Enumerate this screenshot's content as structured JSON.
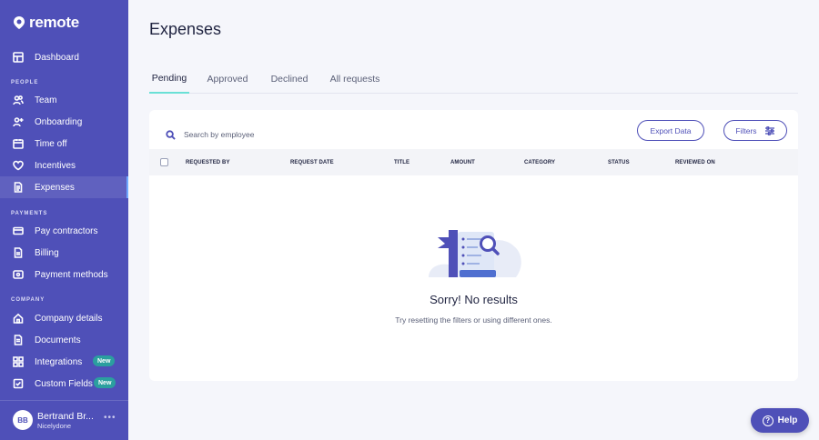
{
  "app": {
    "logo_text": "remote"
  },
  "sidebar": {
    "dashboard": "Dashboard",
    "section_people": "PEOPLE",
    "section_payments": "PAYMENTS",
    "section_company": "COMPANY",
    "items": [
      {
        "label": "Team",
        "icon": "users-icon"
      },
      {
        "label": "Onboarding",
        "icon": "user-plus-icon"
      },
      {
        "label": "Time off",
        "icon": "calendar-icon"
      },
      {
        "label": "Incentives",
        "icon": "heart-icon"
      },
      {
        "label": "Expenses",
        "icon": "receipt-icon"
      },
      {
        "label": "Pay contractors",
        "icon": "card-icon"
      },
      {
        "label": "Billing",
        "icon": "document-icon"
      },
      {
        "label": "Payment methods",
        "icon": "wallet-icon"
      },
      {
        "label": "Company details",
        "icon": "home-icon"
      },
      {
        "label": "Documents",
        "icon": "file-icon"
      },
      {
        "label": "Integrations",
        "icon": "grid-icon",
        "badge": "New"
      },
      {
        "label": "Custom Fields",
        "icon": "checkbox-icon",
        "badge": "New"
      }
    ],
    "user": {
      "initials": "BB",
      "name": "Bertrand Br...",
      "company": "Nicelydone"
    }
  },
  "page": {
    "title": "Expenses",
    "tabs": [
      "Pending",
      "Approved",
      "Declined",
      "All requests"
    ],
    "active_tab": "Pending",
    "search_placeholder": "Search by employee",
    "export_label": "Export Data",
    "filters_label": "Filters",
    "columns": [
      "REQUESTED BY",
      "REQUEST DATE",
      "TITLE",
      "AMOUNT",
      "CATEGORY",
      "STATUS",
      "REVIEWED ON"
    ],
    "empty_title": "Sorry! No results",
    "empty_subtitle": "Try resetting the filters or using different ones."
  },
  "help_label": "Help",
  "colors": {
    "sidebar": "#4f50b8",
    "accent_tab": "#6ae0d6",
    "badge": "#2b9f9f"
  }
}
